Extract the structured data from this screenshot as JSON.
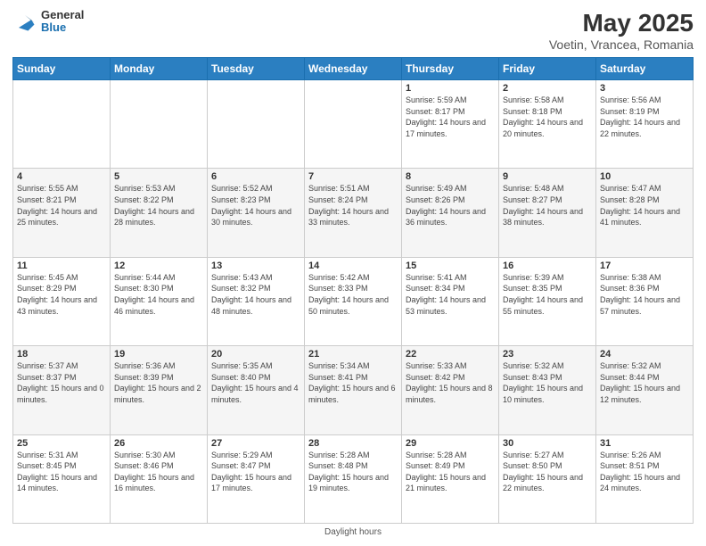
{
  "header": {
    "logo_general": "General",
    "logo_blue": "Blue",
    "title": "May 2025",
    "subtitle": "Voetin, Vrancea, Romania"
  },
  "days_of_week": [
    "Sunday",
    "Monday",
    "Tuesday",
    "Wednesday",
    "Thursday",
    "Friday",
    "Saturday"
  ],
  "footer": {
    "daylight_label": "Daylight hours"
  },
  "weeks": [
    [
      {
        "day": "",
        "sunrise": "",
        "sunset": "",
        "daylight": ""
      },
      {
        "day": "",
        "sunrise": "",
        "sunset": "",
        "daylight": ""
      },
      {
        "day": "",
        "sunrise": "",
        "sunset": "",
        "daylight": ""
      },
      {
        "day": "",
        "sunrise": "",
        "sunset": "",
        "daylight": ""
      },
      {
        "day": "1",
        "sunrise": "Sunrise: 5:59 AM",
        "sunset": "Sunset: 8:17 PM",
        "daylight": "Daylight: 14 hours and 17 minutes."
      },
      {
        "day": "2",
        "sunrise": "Sunrise: 5:58 AM",
        "sunset": "Sunset: 8:18 PM",
        "daylight": "Daylight: 14 hours and 20 minutes."
      },
      {
        "day": "3",
        "sunrise": "Sunrise: 5:56 AM",
        "sunset": "Sunset: 8:19 PM",
        "daylight": "Daylight: 14 hours and 22 minutes."
      }
    ],
    [
      {
        "day": "4",
        "sunrise": "Sunrise: 5:55 AM",
        "sunset": "Sunset: 8:21 PM",
        "daylight": "Daylight: 14 hours and 25 minutes."
      },
      {
        "day": "5",
        "sunrise": "Sunrise: 5:53 AM",
        "sunset": "Sunset: 8:22 PM",
        "daylight": "Daylight: 14 hours and 28 minutes."
      },
      {
        "day": "6",
        "sunrise": "Sunrise: 5:52 AM",
        "sunset": "Sunset: 8:23 PM",
        "daylight": "Daylight: 14 hours and 30 minutes."
      },
      {
        "day": "7",
        "sunrise": "Sunrise: 5:51 AM",
        "sunset": "Sunset: 8:24 PM",
        "daylight": "Daylight: 14 hours and 33 minutes."
      },
      {
        "day": "8",
        "sunrise": "Sunrise: 5:49 AM",
        "sunset": "Sunset: 8:26 PM",
        "daylight": "Daylight: 14 hours and 36 minutes."
      },
      {
        "day": "9",
        "sunrise": "Sunrise: 5:48 AM",
        "sunset": "Sunset: 8:27 PM",
        "daylight": "Daylight: 14 hours and 38 minutes."
      },
      {
        "day": "10",
        "sunrise": "Sunrise: 5:47 AM",
        "sunset": "Sunset: 8:28 PM",
        "daylight": "Daylight: 14 hours and 41 minutes."
      }
    ],
    [
      {
        "day": "11",
        "sunrise": "Sunrise: 5:45 AM",
        "sunset": "Sunset: 8:29 PM",
        "daylight": "Daylight: 14 hours and 43 minutes."
      },
      {
        "day": "12",
        "sunrise": "Sunrise: 5:44 AM",
        "sunset": "Sunset: 8:30 PM",
        "daylight": "Daylight: 14 hours and 46 minutes."
      },
      {
        "day": "13",
        "sunrise": "Sunrise: 5:43 AM",
        "sunset": "Sunset: 8:32 PM",
        "daylight": "Daylight: 14 hours and 48 minutes."
      },
      {
        "day": "14",
        "sunrise": "Sunrise: 5:42 AM",
        "sunset": "Sunset: 8:33 PM",
        "daylight": "Daylight: 14 hours and 50 minutes."
      },
      {
        "day": "15",
        "sunrise": "Sunrise: 5:41 AM",
        "sunset": "Sunset: 8:34 PM",
        "daylight": "Daylight: 14 hours and 53 minutes."
      },
      {
        "day": "16",
        "sunrise": "Sunrise: 5:39 AM",
        "sunset": "Sunset: 8:35 PM",
        "daylight": "Daylight: 14 hours and 55 minutes."
      },
      {
        "day": "17",
        "sunrise": "Sunrise: 5:38 AM",
        "sunset": "Sunset: 8:36 PM",
        "daylight": "Daylight: 14 hours and 57 minutes."
      }
    ],
    [
      {
        "day": "18",
        "sunrise": "Sunrise: 5:37 AM",
        "sunset": "Sunset: 8:37 PM",
        "daylight": "Daylight: 15 hours and 0 minutes."
      },
      {
        "day": "19",
        "sunrise": "Sunrise: 5:36 AM",
        "sunset": "Sunset: 8:39 PM",
        "daylight": "Daylight: 15 hours and 2 minutes."
      },
      {
        "day": "20",
        "sunrise": "Sunrise: 5:35 AM",
        "sunset": "Sunset: 8:40 PM",
        "daylight": "Daylight: 15 hours and 4 minutes."
      },
      {
        "day": "21",
        "sunrise": "Sunrise: 5:34 AM",
        "sunset": "Sunset: 8:41 PM",
        "daylight": "Daylight: 15 hours and 6 minutes."
      },
      {
        "day": "22",
        "sunrise": "Sunrise: 5:33 AM",
        "sunset": "Sunset: 8:42 PM",
        "daylight": "Daylight: 15 hours and 8 minutes."
      },
      {
        "day": "23",
        "sunrise": "Sunrise: 5:32 AM",
        "sunset": "Sunset: 8:43 PM",
        "daylight": "Daylight: 15 hours and 10 minutes."
      },
      {
        "day": "24",
        "sunrise": "Sunrise: 5:32 AM",
        "sunset": "Sunset: 8:44 PM",
        "daylight": "Daylight: 15 hours and 12 minutes."
      }
    ],
    [
      {
        "day": "25",
        "sunrise": "Sunrise: 5:31 AM",
        "sunset": "Sunset: 8:45 PM",
        "daylight": "Daylight: 15 hours and 14 minutes."
      },
      {
        "day": "26",
        "sunrise": "Sunrise: 5:30 AM",
        "sunset": "Sunset: 8:46 PM",
        "daylight": "Daylight: 15 hours and 16 minutes."
      },
      {
        "day": "27",
        "sunrise": "Sunrise: 5:29 AM",
        "sunset": "Sunset: 8:47 PM",
        "daylight": "Daylight: 15 hours and 17 minutes."
      },
      {
        "day": "28",
        "sunrise": "Sunrise: 5:28 AM",
        "sunset": "Sunset: 8:48 PM",
        "daylight": "Daylight: 15 hours and 19 minutes."
      },
      {
        "day": "29",
        "sunrise": "Sunrise: 5:28 AM",
        "sunset": "Sunset: 8:49 PM",
        "daylight": "Daylight: 15 hours and 21 minutes."
      },
      {
        "day": "30",
        "sunrise": "Sunrise: 5:27 AM",
        "sunset": "Sunset: 8:50 PM",
        "daylight": "Daylight: 15 hours and 22 minutes."
      },
      {
        "day": "31",
        "sunrise": "Sunrise: 5:26 AM",
        "sunset": "Sunset: 8:51 PM",
        "daylight": "Daylight: 15 hours and 24 minutes."
      }
    ]
  ]
}
